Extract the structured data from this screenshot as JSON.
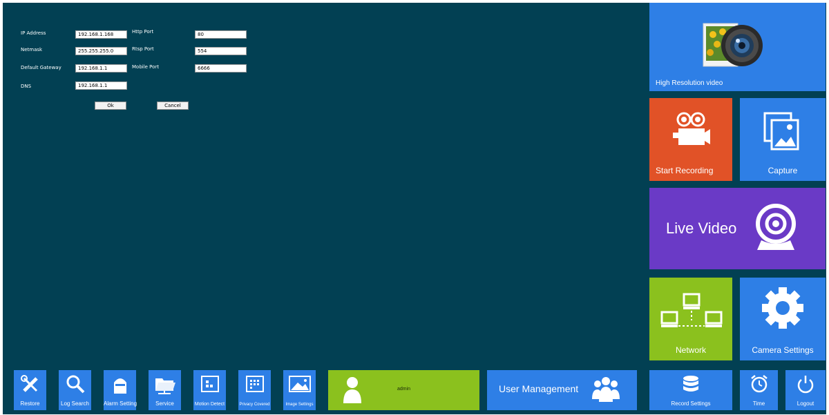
{
  "network_form": {
    "ip_address_label": "IP Address",
    "ip_address_value": "192.168.1.168",
    "netmask_label": "Netmask",
    "netmask_value": "255.255.255.0",
    "gateway_label": "Default Gateway",
    "gateway_value": "192.168.1.1",
    "dns_label": "DNS",
    "dns_value": "192.168.1.1",
    "http_port_label": "Http Port",
    "http_port_value": "80",
    "rtsp_port_label": "Rtsp Port",
    "rtsp_port_value": "554",
    "mobile_port_label": "Mobile Port",
    "mobile_port_value": "6666",
    "ok_label": "Ok",
    "cancel_label": "Cancel"
  },
  "tiles": {
    "high_resolution": "High Resolution video",
    "start_recording": "Start Recording",
    "capture": "Capture",
    "live_video": "Live Video",
    "network": "Network",
    "camera_settings": "Camera Settings"
  },
  "bottom_bar": {
    "restore": "Restore",
    "log_search": "Log Search",
    "alarm_setting": "Alarm Setting",
    "service": "Service",
    "motion_detect": "Motion Detect",
    "privacy_covered": "Privacy Covered",
    "image_settings": "Image Settings",
    "user_name": "admin",
    "user_management": "User Management",
    "record_settings": "Record Settings",
    "time": "Time",
    "logout": "Logout"
  },
  "colors": {
    "background": "#024053",
    "blue": "#2e7fe6",
    "orange": "#e15227",
    "purple": "#6a3ac6",
    "green": "#8bc11e"
  }
}
